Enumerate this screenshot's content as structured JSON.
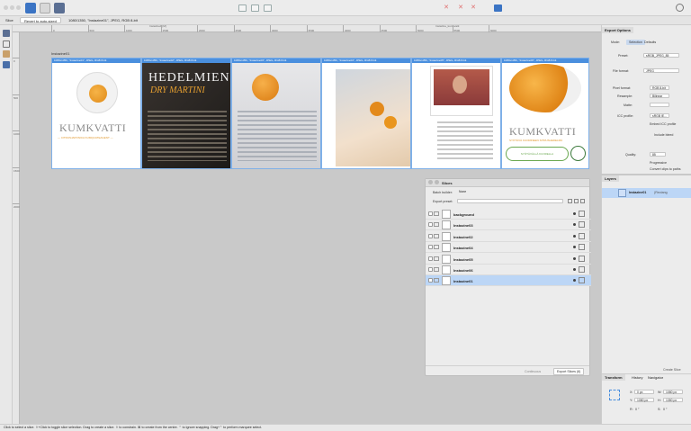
{
  "ctx": {
    "slice_label": "Slice",
    "revert_button": "Revert to auto-sized",
    "slice_info": "1080/1350, \"Instazine01\", JPEG, RGB 8-bit"
  },
  "ruler": {
    "top_ticks": [
      "0",
      "500",
      "1000",
      "1500",
      "2000",
      "2500",
      "3000",
      "3500",
      "4000",
      "4500",
      "5000",
      "5500",
      "6000"
    ],
    "left_ticks": [
      "0",
      "500",
      "1000",
      "1500",
      "2000"
    ],
    "top_caption_1": "Instazine1 [M]",
    "top_caption_2": "Instazine_kumkvatti"
  },
  "doc": {
    "name": "Instazine01"
  },
  "slices": {
    "s1": {
      "bar": "1080x1350, \"Instazine01\", JPEG, RGB 8-bit",
      "brand": "KUMKVATTI",
      "sub": "— CITRUSJAPONICA KUMQUATEAGENT —"
    },
    "s2": {
      "bar": "1080x1350, \"Instazine02\", JPEG, RGB 8-bit",
      "title": "HEDELMIEN",
      "subtitle": "DRY MARTINI"
    },
    "s3": {
      "bar": "1080x1350, \"Instazine03\", JPEG, RGB 8-bit"
    },
    "s4": {
      "bar": "1080x1350, \"Instazine04\", JPEG, RGB 8-bit"
    },
    "s5": {
      "bar": "1080x1350, \"Instazine05\", JPEG, RGB 8-bit"
    },
    "s6": {
      "bar": "1080x1350, \"Instazine06\", JPEG, RGB 8-bit",
      "brand": "KUMKVATTI",
      "sub": "SYÖTÄVÄ KUORINEEN SITRUSHEDELMÄ",
      "badge": "SYÖTÄVÄLLÄ KUORELLA"
    }
  },
  "export": {
    "tab_title": "Export Options",
    "mode_label": "Mode:",
    "mode_selection": "Selection",
    "mode_defaults": "Defaults",
    "preset_label": "Preset:",
    "preset_value": "sRGB_JPEG_85",
    "fileformat_label": "File format:",
    "fileformat_value": "JPEG",
    "pixelformat_label": "Pixel format:",
    "pixelformat_value": "RGB 8-bit",
    "resample_label": "Resample:",
    "resample_value": "Bilinear",
    "matte_label": "Matte:",
    "icc_label": "ICC profile:",
    "icc_value": "sRGB IE...",
    "embed_icc": "Embed ICC profile",
    "include_bleed": "Include bleed",
    "quality_label": "Quality:",
    "quality_value": "85",
    "progressive": "Progressive",
    "convert_clips": "Convert clips to paths"
  },
  "layers": {
    "title": "Layers",
    "row_name": "Instazine01",
    "row_type": "(Rectang",
    "create_slice": "Create Slice"
  },
  "slices_panel": {
    "title": "Slices",
    "export_folder_label": "Batch builder:",
    "export_folder_value": "None",
    "export_preset_label": "Export preset:",
    "continuous": "Continuous",
    "export_button": "Export Slices (6)",
    "rows": [
      "background",
      "Instazine03",
      "Instazine02",
      "Instazine04",
      "Instazine05",
      "Instazine06",
      "Instazine01"
    ]
  },
  "transform": {
    "tab_transform": "Transform",
    "tab_history": "History",
    "tab_navigator": "Navigator",
    "x_label": "X:",
    "x_value": "0 px",
    "y_label": "Y:",
    "y_value": "1080 px",
    "w_label": "W:",
    "w_value": "1080 px",
    "h_label": "H:",
    "h_value": "1350 px",
    "r_label": "R:",
    "r_value": "0 °",
    "s_label": "S:",
    "s_value": "0 °"
  },
  "status": {
    "text": "Click to select a slice. ⇧+Click to toggle slice selection. Drag to create a slice. ⇧ to constrain. ⌘ to create from the centre. ⌃ to ignore snapping. Drag+⌃ to perform marquee select."
  }
}
